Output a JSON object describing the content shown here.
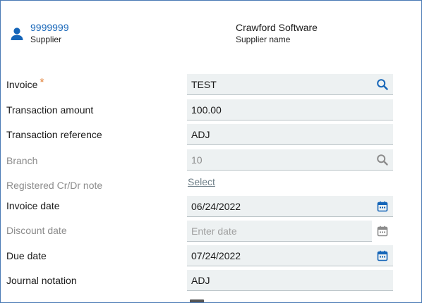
{
  "header": {
    "supplier_id": "9999999",
    "supplier_label": "Supplier",
    "supplier_name": "Crawford Software",
    "supplier_name_label": "Supplier name"
  },
  "form": {
    "invoice": {
      "label": "Invoice",
      "required_mark": "*",
      "value": "TEST",
      "icon": "search-icon"
    },
    "transaction_amount": {
      "label": "Transaction amount",
      "value": "100.00"
    },
    "transaction_reference": {
      "label": "Transaction reference",
      "value": "ADJ"
    },
    "branch": {
      "label": "Branch",
      "value": "10",
      "icon": "search-icon",
      "disabled": true
    },
    "registered_note": {
      "label": "Registered Cr/Dr note",
      "link": "Select",
      "disabled": true
    },
    "invoice_date": {
      "label": "Invoice date",
      "value": "06/24/2022",
      "icon": "calendar-icon"
    },
    "discount_date": {
      "label": "Discount date",
      "placeholder": "Enter date",
      "icon": "calendar-icon",
      "disabled": true
    },
    "due_date": {
      "label": "Due date",
      "value": "07/24/2022",
      "icon": "calendar-icon"
    },
    "journal_notation": {
      "label": "Journal notation",
      "value": "ADJ"
    }
  },
  "colors": {
    "accent": "#1565b8",
    "required": "#e07a2e",
    "field_bg": "#edf1f2",
    "disabled_text": "#8c8c8c"
  }
}
